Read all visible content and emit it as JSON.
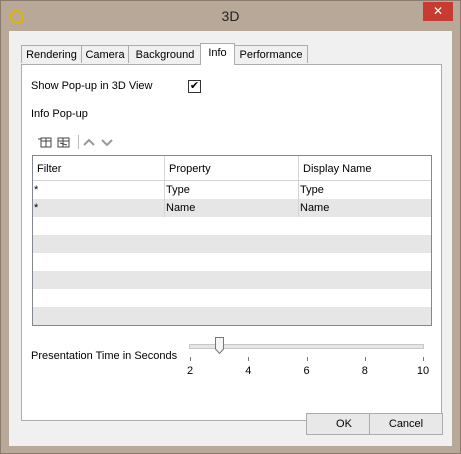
{
  "window": {
    "title": "3D",
    "close_glyph": "✕"
  },
  "tabs": [
    {
      "label": "Rendering",
      "active": false
    },
    {
      "label": "Camera",
      "active": false
    },
    {
      "label": "Background",
      "active": false
    },
    {
      "label": "Info",
      "active": true
    },
    {
      "label": "Performance",
      "active": false
    }
  ],
  "info": {
    "show_popup_label": "Show Pop-up in 3D View",
    "show_popup_checked": "✔",
    "popup_section_label": "Info Pop-up",
    "toolbar_icons": [
      "add-row-icon",
      "remove-row-icon",
      "move-up-icon",
      "move-down-icon"
    ],
    "grid": {
      "columns": [
        "Filter",
        "Property",
        "Display Name"
      ],
      "rows": [
        [
          "*",
          "Type",
          "Type"
        ],
        [
          "*",
          "Name",
          "Name"
        ]
      ]
    }
  },
  "presentation_time": {
    "label": "Presentation Time in Seconds",
    "ticks": [
      "2",
      "4",
      "6",
      "8",
      "10"
    ],
    "min": 2,
    "max": 10,
    "value": 3
  },
  "buttons": {
    "ok": "OK",
    "cancel": "Cancel"
  }
}
